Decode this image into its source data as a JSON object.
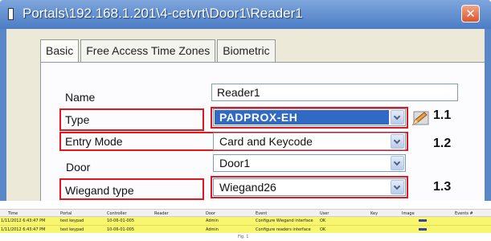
{
  "window": {
    "title": "Portals\\192.168.1.201\\4-cetvrt\\Door1\\Reader1",
    "close_glyph": "✕"
  },
  "tabs": [
    {
      "label": "Basic",
      "active": true
    },
    {
      "label": "Free Access Time Zones",
      "active": false
    },
    {
      "label": "Biometric",
      "active": false
    }
  ],
  "form": {
    "name": {
      "label": "Name",
      "value": "Reader1"
    },
    "type": {
      "label": "Type",
      "value": "PADPROX-EH",
      "callout": "1.1"
    },
    "entry_mode": {
      "label": "Entry Mode",
      "value": "Card and Keycode",
      "callout": "1.2"
    },
    "door": {
      "label": "Door",
      "value": "Door1"
    },
    "wiegand_type": {
      "label": "Wiegand type",
      "value": "Wiegand26",
      "callout": "1.3"
    }
  },
  "colors": {
    "highlight": "#e0191f",
    "selection": "#316ac5",
    "log_row": "#f8f56f"
  },
  "log": {
    "columns": [
      "Time",
      "Portal",
      "Controller",
      "Reader",
      "Door",
      "Event",
      "User",
      "Key",
      "Image",
      "Events #"
    ],
    "rows": [
      {
        "time": "1/11/2012 6:43:47 PM",
        "portal": "test keypad",
        "controller": "10-06-01-005",
        "reader": "",
        "door": "Admin",
        "event": "Configure Wiegand interface",
        "user": "OK",
        "key": "",
        "events": ""
      },
      {
        "time": "1/11/2012 6:43:47 PM",
        "portal": "test keypad",
        "controller": "10-06-01-005",
        "reader": "",
        "door": "Admin",
        "event": "Configure readers interface",
        "user": "OK",
        "key": "",
        "events": ""
      }
    ]
  },
  "caption": "Fig. 1"
}
